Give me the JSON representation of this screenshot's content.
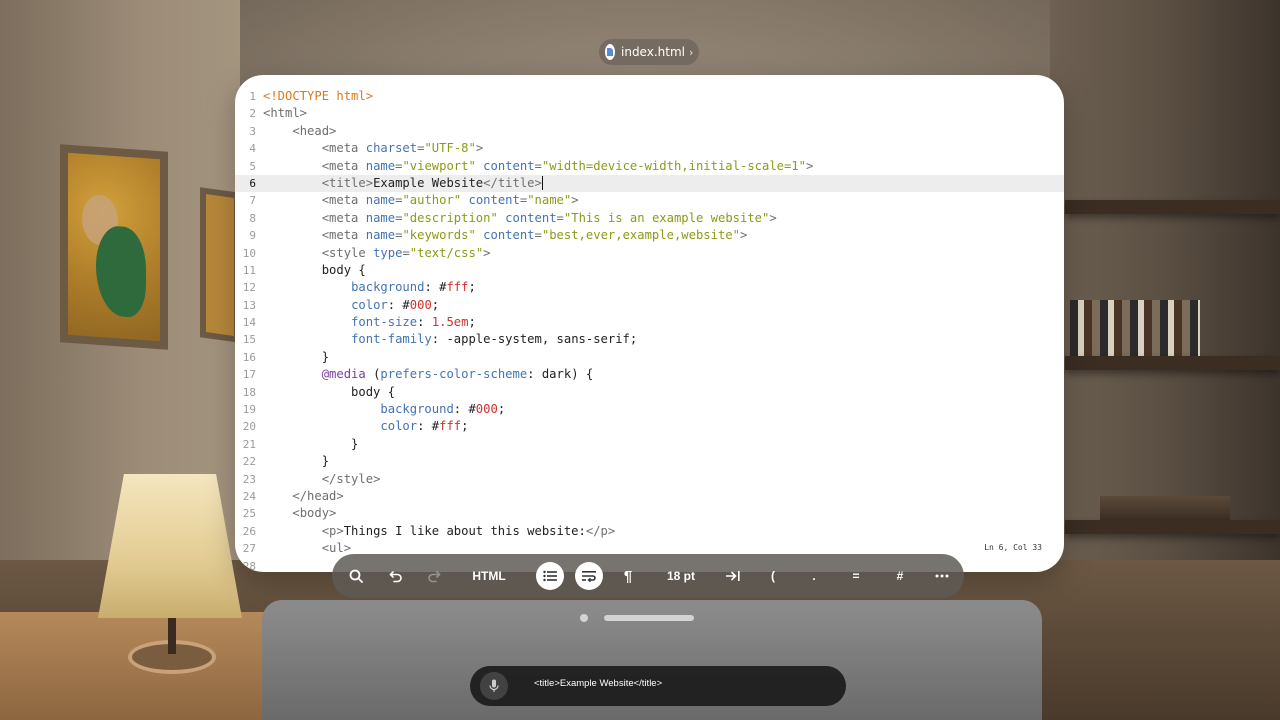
{
  "window": {
    "filename": "index.html",
    "file_icon": "html-file-icon"
  },
  "editor": {
    "status": "Ln 6, Col 33",
    "current_line": 6,
    "lines": [
      {
        "n": "1",
        "tokens": [
          [
            "c-doc",
            "<!DOCTYPE html>"
          ]
        ]
      },
      {
        "n": "2",
        "tokens": [
          [
            "c-tag",
            "<html>"
          ]
        ]
      },
      {
        "n": "3",
        "tokens": [
          [
            "c-plain",
            "    "
          ],
          [
            "c-tag",
            "<head>"
          ]
        ]
      },
      {
        "n": "4",
        "tokens": [
          [
            "c-plain",
            "        "
          ],
          [
            "c-tag",
            "<meta "
          ],
          [
            "c-attr",
            "charset"
          ],
          [
            "c-tag",
            "="
          ],
          [
            "c-str",
            "\"UTF-8\""
          ],
          [
            "c-tag",
            ">"
          ]
        ]
      },
      {
        "n": "5",
        "tokens": [
          [
            "c-plain",
            "        "
          ],
          [
            "c-tag",
            "<meta "
          ],
          [
            "c-attr",
            "name"
          ],
          [
            "c-tag",
            "="
          ],
          [
            "c-str",
            "\"viewport\""
          ],
          [
            "c-plain",
            " "
          ],
          [
            "c-attr",
            "content"
          ],
          [
            "c-tag",
            "="
          ],
          [
            "c-str",
            "\"width=device-width,initial-scale=1\""
          ],
          [
            "c-tag",
            ">"
          ]
        ]
      },
      {
        "n": "6",
        "tokens": [
          [
            "c-plain",
            "        "
          ],
          [
            "c-tag",
            "<title>"
          ],
          [
            "c-plain",
            "Example Website"
          ],
          [
            "c-tag",
            "</title>"
          ]
        ]
      },
      {
        "n": "7",
        "tokens": [
          [
            "c-plain",
            "        "
          ],
          [
            "c-tag",
            "<meta "
          ],
          [
            "c-attr",
            "name"
          ],
          [
            "c-tag",
            "="
          ],
          [
            "c-str",
            "\"author\""
          ],
          [
            "c-plain",
            " "
          ],
          [
            "c-attr",
            "content"
          ],
          [
            "c-tag",
            "="
          ],
          [
            "c-str",
            "\"name\""
          ],
          [
            "c-tag",
            ">"
          ]
        ]
      },
      {
        "n": "8",
        "tokens": [
          [
            "c-plain",
            "        "
          ],
          [
            "c-tag",
            "<meta "
          ],
          [
            "c-attr",
            "name"
          ],
          [
            "c-tag",
            "="
          ],
          [
            "c-str",
            "\"description\""
          ],
          [
            "c-plain",
            " "
          ],
          [
            "c-attr",
            "content"
          ],
          [
            "c-tag",
            "="
          ],
          [
            "c-str",
            "\"This is an example website\""
          ],
          [
            "c-tag",
            ">"
          ]
        ]
      },
      {
        "n": "9",
        "tokens": [
          [
            "c-plain",
            "        "
          ],
          [
            "c-tag",
            "<meta "
          ],
          [
            "c-attr",
            "name"
          ],
          [
            "c-tag",
            "="
          ],
          [
            "c-str",
            "\"keywords\""
          ],
          [
            "c-plain",
            " "
          ],
          [
            "c-attr",
            "content"
          ],
          [
            "c-tag",
            "="
          ],
          [
            "c-str",
            "\"best,ever,example,website\""
          ],
          [
            "c-tag",
            ">"
          ]
        ]
      },
      {
        "n": "10",
        "tokens": [
          [
            "c-plain",
            "        "
          ],
          [
            "c-tag",
            "<style "
          ],
          [
            "c-attr",
            "type"
          ],
          [
            "c-tag",
            "="
          ],
          [
            "c-str",
            "\"text/css\""
          ],
          [
            "c-tag",
            ">"
          ]
        ]
      },
      {
        "n": "11",
        "tokens": [
          [
            "c-plain",
            "        body {"
          ]
        ]
      },
      {
        "n": "12",
        "tokens": [
          [
            "c-plain",
            "            "
          ],
          [
            "c-prop",
            "background"
          ],
          [
            "c-plain",
            ": #"
          ],
          [
            "c-num",
            "fff"
          ],
          [
            "c-plain",
            ";"
          ]
        ]
      },
      {
        "n": "13",
        "tokens": [
          [
            "c-plain",
            "            "
          ],
          [
            "c-prop",
            "color"
          ],
          [
            "c-plain",
            ": #"
          ],
          [
            "c-num",
            "000"
          ],
          [
            "c-plain",
            ";"
          ]
        ]
      },
      {
        "n": "14",
        "tokens": [
          [
            "c-plain",
            "            "
          ],
          [
            "c-prop",
            "font-size"
          ],
          [
            "c-plain",
            ": "
          ],
          [
            "c-num",
            "1.5em"
          ],
          [
            "c-plain",
            ";"
          ]
        ]
      },
      {
        "n": "15",
        "tokens": [
          [
            "c-plain",
            "            "
          ],
          [
            "c-prop",
            "font-family"
          ],
          [
            "c-plain",
            ": -apple-system, sans-serif;"
          ]
        ]
      },
      {
        "n": "16",
        "tokens": [
          [
            "c-plain",
            "        }"
          ]
        ]
      },
      {
        "n": "17",
        "tokens": [
          [
            "c-plain",
            "        "
          ],
          [
            "c-at",
            "@media"
          ],
          [
            "c-plain",
            " ("
          ],
          [
            "c-prop",
            "prefers-color-scheme"
          ],
          [
            "c-plain",
            ": dark) {"
          ]
        ]
      },
      {
        "n": "18",
        "tokens": [
          [
            "c-plain",
            "            body {"
          ]
        ]
      },
      {
        "n": "19",
        "tokens": [
          [
            "c-plain",
            "                "
          ],
          [
            "c-prop",
            "background"
          ],
          [
            "c-plain",
            ": #"
          ],
          [
            "c-num",
            "000"
          ],
          [
            "c-plain",
            ";"
          ]
        ]
      },
      {
        "n": "20",
        "tokens": [
          [
            "c-plain",
            "                "
          ],
          [
            "c-prop",
            "color"
          ],
          [
            "c-plain",
            ": #"
          ],
          [
            "c-num",
            "fff"
          ],
          [
            "c-plain",
            ";"
          ]
        ]
      },
      {
        "n": "21",
        "tokens": [
          [
            "c-plain",
            "            }"
          ]
        ]
      },
      {
        "n": "22",
        "tokens": [
          [
            "c-plain",
            "        }"
          ]
        ]
      },
      {
        "n": "23",
        "tokens": [
          [
            "c-plain",
            "        "
          ],
          [
            "c-tag",
            "</style>"
          ]
        ]
      },
      {
        "n": "24",
        "tokens": [
          [
            "c-plain",
            "    "
          ],
          [
            "c-tag",
            "</head>"
          ]
        ]
      },
      {
        "n": "25",
        "tokens": [
          [
            "c-plain",
            "    "
          ],
          [
            "c-tag",
            "<body>"
          ]
        ]
      },
      {
        "n": "26",
        "tokens": [
          [
            "c-plain",
            "        "
          ],
          [
            "c-tag",
            "<p>"
          ],
          [
            "c-plain",
            "Things I like about this website:"
          ],
          [
            "c-tag",
            "</p>"
          ]
        ]
      },
      {
        "n": "27",
        "tokens": [
          [
            "c-plain",
            "        "
          ],
          [
            "c-tag",
            "<ul>"
          ]
        ]
      },
      {
        "n": "28",
        "tokens": []
      }
    ]
  },
  "toolbar": {
    "search_icon": "search-icon",
    "undo_icon": "undo-icon",
    "redo_icon": "redo-icon",
    "language_label": "HTML",
    "list_icon": "list-icon",
    "wrap_icon": "wrap-icon",
    "pilcrow": "¶",
    "font_size_label": "18 pt",
    "indent_icon": "indent-icon",
    "paren": "(",
    "dot": ".",
    "equals": "=",
    "hash": "#",
    "more_icon": "more-icon"
  },
  "dictation": {
    "mic_icon": "microphone-icon",
    "text": "<title>Example Website</title>"
  },
  "colors": {
    "doctype": "#d67b1e",
    "tag": "#6f6f6f",
    "attribute": "#4373b5",
    "string": "#8d9a16",
    "number": "#d0312d",
    "at_rule": "#7a3ea0"
  }
}
